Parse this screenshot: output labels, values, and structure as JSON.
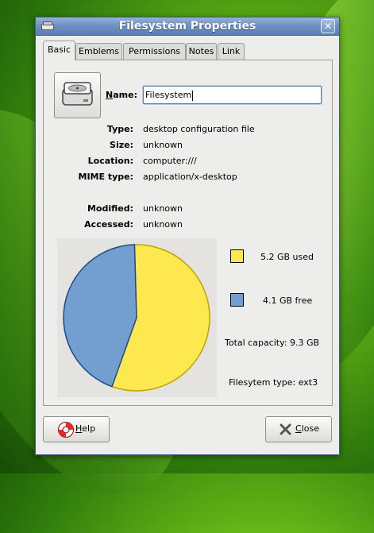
{
  "window": {
    "title": "Filesystem Properties",
    "close_glyph": "✕"
  },
  "tabs": [
    {
      "label": "Basic",
      "active": true
    },
    {
      "label": "Emblems",
      "active": false
    },
    {
      "label": "Permissions",
      "active": false
    },
    {
      "label": "Notes",
      "active": false
    },
    {
      "label": "Link",
      "active": false
    }
  ],
  "basic": {
    "icon": "harddisk-icon",
    "name_label_first": "N",
    "name_label_rest": "ame:",
    "name_value": "Filesystem",
    "props": [
      {
        "key": "Type:",
        "value": "desktop configuration file"
      },
      {
        "key": "Size:",
        "value": "unknown"
      },
      {
        "key": "Location:",
        "value": "computer:///"
      },
      {
        "key": "MIME type:",
        "value": "application/x-desktop"
      },
      {
        "key": "Modified:",
        "value": "unknown"
      },
      {
        "key": "Accessed:",
        "value": "unknown"
      }
    ]
  },
  "chart_data": {
    "type": "pie",
    "series": [
      {
        "name": "5.2 GB used",
        "value": 5.2,
        "color": "#fce94f"
      },
      {
        "name": "4.1 GB free",
        "value": 4.1,
        "color": "#729fcf"
      }
    ],
    "total_capacity": "Total capacity: 9.3 GB",
    "filesystem_type": "Filesytem type: ext3"
  },
  "buttons": {
    "help_first": "H",
    "help_rest": "elp",
    "close_first": "C",
    "close_rest": "lose"
  },
  "colors": {
    "titlebar": "#6d8fc1",
    "used": "#fce94f",
    "free": "#729fcf"
  }
}
